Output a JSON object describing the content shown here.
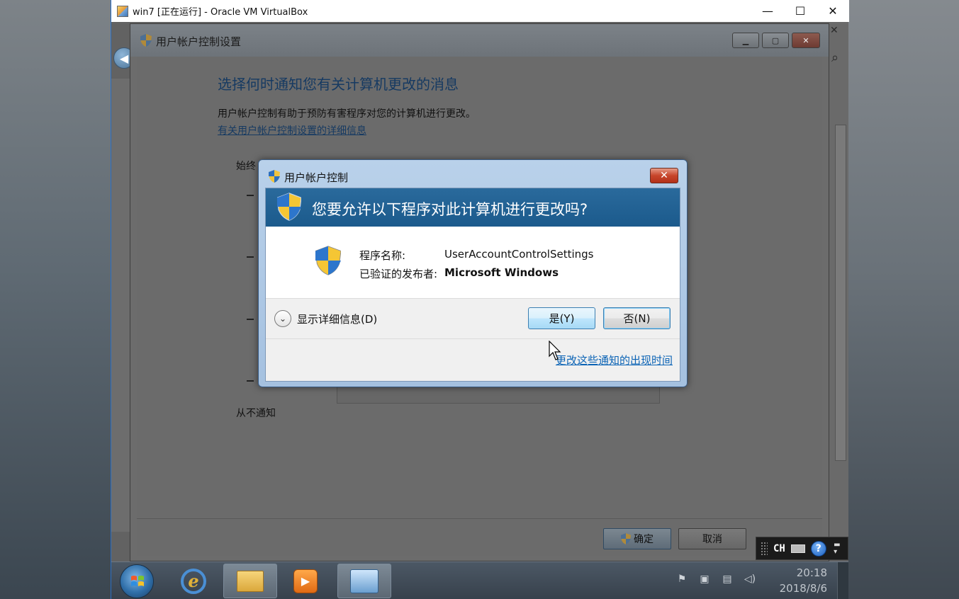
{
  "host": {
    "title": "win7 [正在运行] - Oracle VM VirtualBox",
    "controls": {
      "minimize": "—",
      "maximize": "☐",
      "close": "✕"
    }
  },
  "settings": {
    "title": "用户帐户控制设置",
    "heading": "选择何时通知您有关计算机更改的消息",
    "description": "用户帐户控制有助于预防有害程序对您的计算机进行更改。",
    "link": "有关用户帐户控制设置的详细信息",
    "always_label": "始终",
    "never_label": "从不通知",
    "ok_label": "确定",
    "cancel_label": "取消"
  },
  "uac": {
    "title": "用户帐户控制",
    "question": "您要允许以下程序对此计算机进行更改吗?",
    "program_label": "程序名称:",
    "program_value": "UserAccountControlSettings",
    "publisher_label": "已验证的发布者:",
    "publisher_value": "Microsoft Windows",
    "details_label": "显示详细信息(D)",
    "yes_label": "是(Y)",
    "no_label": "否(N)",
    "change_link": "更改这些通知的出现时间"
  },
  "taskbar": {
    "time": "20:18",
    "date": "2018/8/6"
  },
  "langbar": {
    "lang": "CH",
    "help": "?"
  }
}
